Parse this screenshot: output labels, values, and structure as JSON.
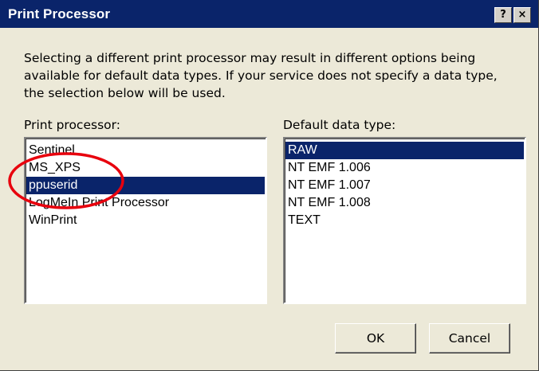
{
  "window": {
    "title": "Print Processor",
    "help_button": "?",
    "close_button": "×"
  },
  "description": "Selecting a different print processor may result in different options being available for default data types. If your service does not specify a data type, the selection below will be used.",
  "print_processor": {
    "label": "Print processor:",
    "items": [
      "Sentinel",
      "MS_XPS",
      "ppuserid",
      "LogMeIn Print Processor",
      "WinPrint"
    ],
    "selected_index": 2
  },
  "default_data_type": {
    "label": "Default data type:",
    "items": [
      "RAW",
      "NT EMF 1.006",
      "NT EMF 1.007",
      "NT EMF 1.008",
      "TEXT"
    ],
    "selected_index": 0
  },
  "buttons": {
    "ok": "OK",
    "cancel": "Cancel"
  },
  "colors": {
    "titlebar": "#0a246a",
    "selection": "#0a246a",
    "dialog_bg": "#ece9d8",
    "annotation": "#e8000d"
  },
  "annotation": {
    "type": "red-ellipse",
    "target": "ppuserid"
  }
}
